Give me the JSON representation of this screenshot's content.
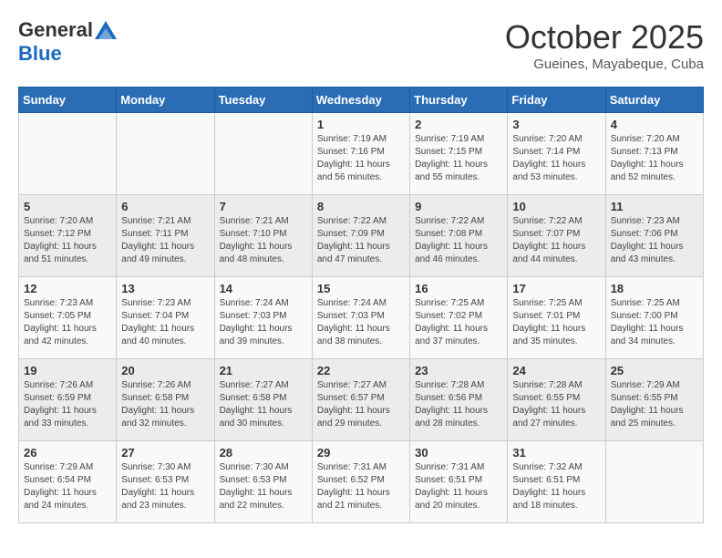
{
  "header": {
    "logo_general": "General",
    "logo_blue": "Blue",
    "month_title": "October 2025",
    "subtitle": "Gueines, Mayabeque, Cuba"
  },
  "days_of_week": [
    "Sunday",
    "Monday",
    "Tuesday",
    "Wednesday",
    "Thursday",
    "Friday",
    "Saturday"
  ],
  "weeks": [
    [
      {
        "day": "",
        "info": ""
      },
      {
        "day": "",
        "info": ""
      },
      {
        "day": "",
        "info": ""
      },
      {
        "day": "1",
        "info": "Sunrise: 7:19 AM\nSunset: 7:16 PM\nDaylight: 11 hours and 56 minutes."
      },
      {
        "day": "2",
        "info": "Sunrise: 7:19 AM\nSunset: 7:15 PM\nDaylight: 11 hours and 55 minutes."
      },
      {
        "day": "3",
        "info": "Sunrise: 7:20 AM\nSunset: 7:14 PM\nDaylight: 11 hours and 53 minutes."
      },
      {
        "day": "4",
        "info": "Sunrise: 7:20 AM\nSunset: 7:13 PM\nDaylight: 11 hours and 52 minutes."
      }
    ],
    [
      {
        "day": "5",
        "info": "Sunrise: 7:20 AM\nSunset: 7:12 PM\nDaylight: 11 hours and 51 minutes."
      },
      {
        "day": "6",
        "info": "Sunrise: 7:21 AM\nSunset: 7:11 PM\nDaylight: 11 hours and 49 minutes."
      },
      {
        "day": "7",
        "info": "Sunrise: 7:21 AM\nSunset: 7:10 PM\nDaylight: 11 hours and 48 minutes."
      },
      {
        "day": "8",
        "info": "Sunrise: 7:22 AM\nSunset: 7:09 PM\nDaylight: 11 hours and 47 minutes."
      },
      {
        "day": "9",
        "info": "Sunrise: 7:22 AM\nSunset: 7:08 PM\nDaylight: 11 hours and 46 minutes."
      },
      {
        "day": "10",
        "info": "Sunrise: 7:22 AM\nSunset: 7:07 PM\nDaylight: 11 hours and 44 minutes."
      },
      {
        "day": "11",
        "info": "Sunrise: 7:23 AM\nSunset: 7:06 PM\nDaylight: 11 hours and 43 minutes."
      }
    ],
    [
      {
        "day": "12",
        "info": "Sunrise: 7:23 AM\nSunset: 7:05 PM\nDaylight: 11 hours and 42 minutes."
      },
      {
        "day": "13",
        "info": "Sunrise: 7:23 AM\nSunset: 7:04 PM\nDaylight: 11 hours and 40 minutes."
      },
      {
        "day": "14",
        "info": "Sunrise: 7:24 AM\nSunset: 7:03 PM\nDaylight: 11 hours and 39 minutes."
      },
      {
        "day": "15",
        "info": "Sunrise: 7:24 AM\nSunset: 7:03 PM\nDaylight: 11 hours and 38 minutes."
      },
      {
        "day": "16",
        "info": "Sunrise: 7:25 AM\nSunset: 7:02 PM\nDaylight: 11 hours and 37 minutes."
      },
      {
        "day": "17",
        "info": "Sunrise: 7:25 AM\nSunset: 7:01 PM\nDaylight: 11 hours and 35 minutes."
      },
      {
        "day": "18",
        "info": "Sunrise: 7:25 AM\nSunset: 7:00 PM\nDaylight: 11 hours and 34 minutes."
      }
    ],
    [
      {
        "day": "19",
        "info": "Sunrise: 7:26 AM\nSunset: 6:59 PM\nDaylight: 11 hours and 33 minutes."
      },
      {
        "day": "20",
        "info": "Sunrise: 7:26 AM\nSunset: 6:58 PM\nDaylight: 11 hours and 32 minutes."
      },
      {
        "day": "21",
        "info": "Sunrise: 7:27 AM\nSunset: 6:58 PM\nDaylight: 11 hours and 30 minutes."
      },
      {
        "day": "22",
        "info": "Sunrise: 7:27 AM\nSunset: 6:57 PM\nDaylight: 11 hours and 29 minutes."
      },
      {
        "day": "23",
        "info": "Sunrise: 7:28 AM\nSunset: 6:56 PM\nDaylight: 11 hours and 28 minutes."
      },
      {
        "day": "24",
        "info": "Sunrise: 7:28 AM\nSunset: 6:55 PM\nDaylight: 11 hours and 27 minutes."
      },
      {
        "day": "25",
        "info": "Sunrise: 7:29 AM\nSunset: 6:55 PM\nDaylight: 11 hours and 25 minutes."
      }
    ],
    [
      {
        "day": "26",
        "info": "Sunrise: 7:29 AM\nSunset: 6:54 PM\nDaylight: 11 hours and 24 minutes."
      },
      {
        "day": "27",
        "info": "Sunrise: 7:30 AM\nSunset: 6:53 PM\nDaylight: 11 hours and 23 minutes."
      },
      {
        "day": "28",
        "info": "Sunrise: 7:30 AM\nSunset: 6:53 PM\nDaylight: 11 hours and 22 minutes."
      },
      {
        "day": "29",
        "info": "Sunrise: 7:31 AM\nSunset: 6:52 PM\nDaylight: 11 hours and 21 minutes."
      },
      {
        "day": "30",
        "info": "Sunrise: 7:31 AM\nSunset: 6:51 PM\nDaylight: 11 hours and 20 minutes."
      },
      {
        "day": "31",
        "info": "Sunrise: 7:32 AM\nSunset: 6:51 PM\nDaylight: 11 hours and 18 minutes."
      },
      {
        "day": "",
        "info": ""
      }
    ]
  ]
}
